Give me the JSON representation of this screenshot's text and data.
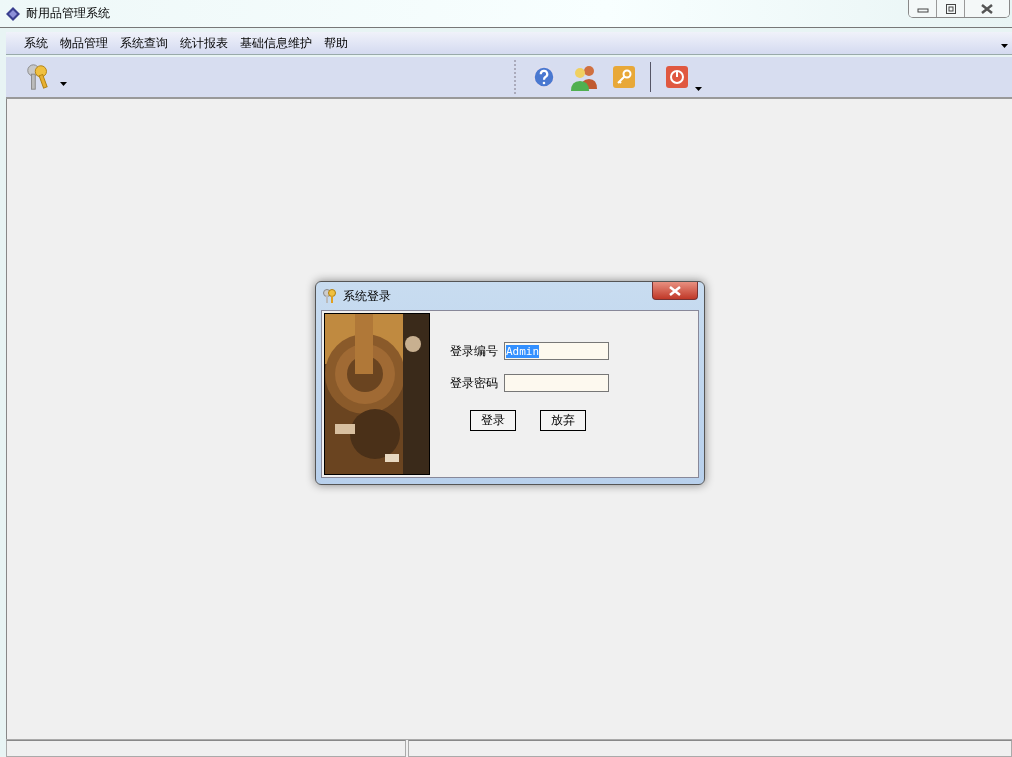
{
  "window": {
    "title": "耐用品管理系统"
  },
  "menu": [
    "系统",
    "物品管理",
    "系统查询",
    "统计报表",
    "基础信息维护",
    "帮助"
  ],
  "dialog": {
    "title": "系统登录",
    "fields": [
      {
        "label": "登录编号",
        "value": "Admin",
        "highlighted": true
      },
      {
        "label": "登录密码"
      }
    ],
    "buttons": [
      "登录",
      "放弃"
    ]
  }
}
